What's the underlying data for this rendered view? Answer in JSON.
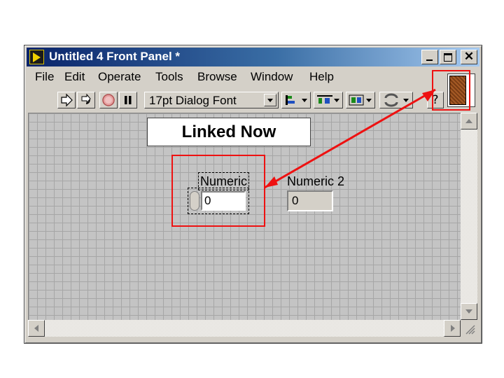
{
  "window": {
    "title": "Untitled 4 Front Panel *",
    "close_glyph": "✕"
  },
  "menu": [
    "File",
    "Edit",
    "Operate",
    "Tools",
    "Browse",
    "Window",
    "Help"
  ],
  "toolbar": {
    "font_label": "17pt Dialog Font",
    "help_glyph": "?"
  },
  "canvas": {
    "annotation": "Linked Now",
    "numeric_control": {
      "label": "Numeric",
      "value": "0"
    },
    "numeric_indicator": {
      "label": "Numeric 2",
      "value": "0"
    }
  },
  "colors": {
    "annotation_red": "#ee1111",
    "title_gradient_start": "#0a246a",
    "terminal_brown": "#7a3c14"
  }
}
